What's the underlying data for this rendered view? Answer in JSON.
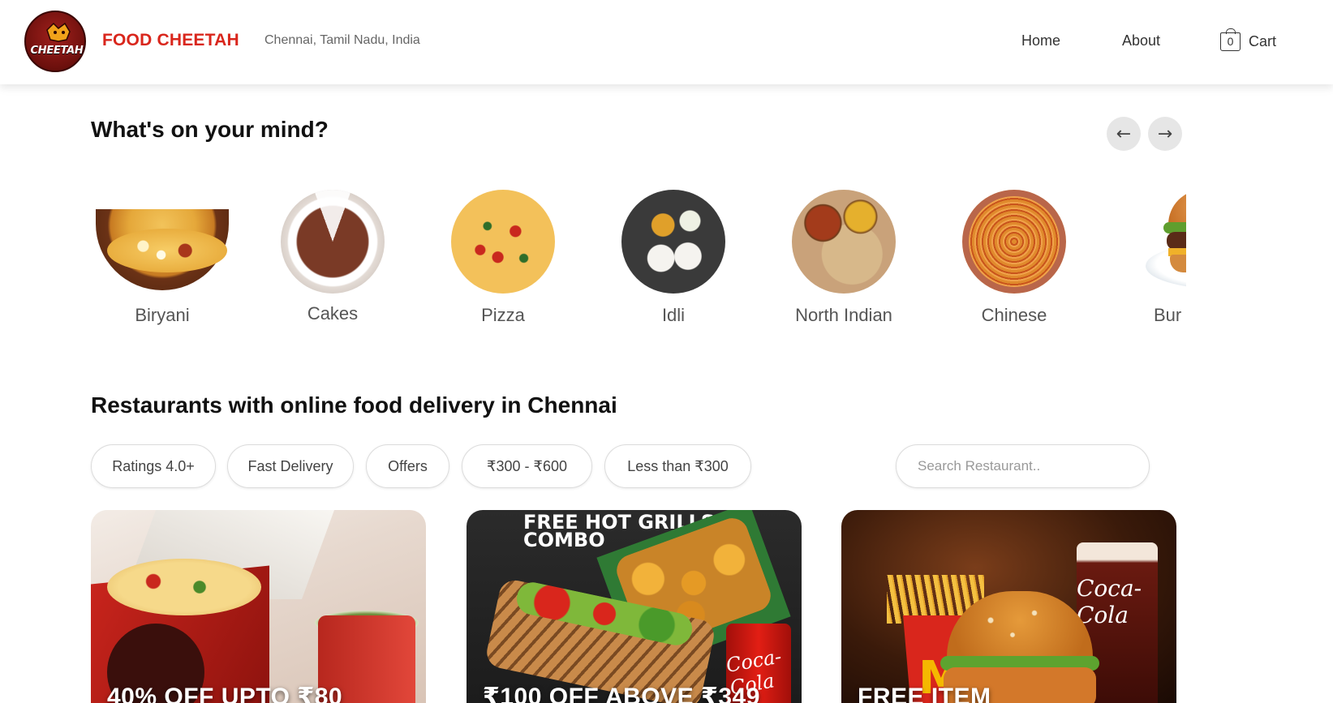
{
  "header": {
    "logo_text": "CHEETAH",
    "brand": "FOOD CHEETAH",
    "location": "Chennai, Tamil Nadu, India",
    "nav": {
      "home": "Home",
      "about": "About",
      "cart_count": "0",
      "cart_label": "Cart"
    }
  },
  "mind_section": {
    "title": "What's on your mind?",
    "categories": [
      {
        "label": "Biryani",
        "icon": "biryani-image"
      },
      {
        "label": "Cakes",
        "icon": "cakes-image"
      },
      {
        "label": "Pizza",
        "icon": "pizza-image"
      },
      {
        "label": "Idli",
        "icon": "idli-image"
      },
      {
        "label": "North Indian",
        "icon": "north-indian-image"
      },
      {
        "label": "Chinese",
        "icon": "chinese-image"
      },
      {
        "label": "Bur",
        "icon": "burger-image"
      }
    ]
  },
  "restaurants_section": {
    "title": "Restaurants with online food delivery in Chennai",
    "filters": [
      "Ratings 4.0+",
      "Fast Delivery",
      "Offers",
      "₹300 - ₹600",
      "Less than ₹300"
    ],
    "search_placeholder": "Search Restaurant..",
    "cards": [
      {
        "offer": "40% OFF UPTO ₹80",
        "combo_text": ""
      },
      {
        "offer": "₹100 OFF ABOVE ₹349",
        "combo_text": "FREE HOT GRILLS COMBO",
        "can_text": "Coca-Cola"
      },
      {
        "offer": "FREE ITEM",
        "logo_text": "M",
        "glass_text": "Coca-Cola"
      }
    ]
  },
  "colors": {
    "brand_red": "#d9261c",
    "arrow_bg": "#e6e6e6"
  }
}
